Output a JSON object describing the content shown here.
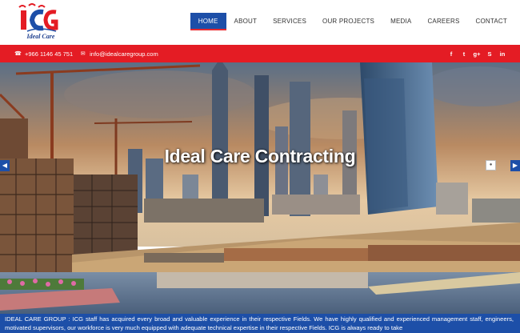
{
  "brand": {
    "logo_text": "Ideal Care",
    "logo_letters": "ICG",
    "colors": {
      "red": "#e41c24",
      "blue": "#1d4fa8"
    }
  },
  "nav": {
    "items": [
      {
        "label": "HOME",
        "active": true
      },
      {
        "label": "ABOUT",
        "active": false
      },
      {
        "label": "SERVICES",
        "active": false
      },
      {
        "label": "OUR PROJECTS",
        "active": false
      },
      {
        "label": "MEDIA",
        "active": false
      },
      {
        "label": "CAREERS",
        "active": false
      },
      {
        "label": "CONTACT",
        "active": false
      }
    ]
  },
  "topbar": {
    "phone_icon": "phone-icon",
    "phone": "+966 1146 45 751",
    "email_icon": "envelope-icon",
    "email": "info@idealcaregroup.com",
    "social": [
      {
        "icon": "facebook-icon",
        "glyph": "f"
      },
      {
        "icon": "twitter-icon",
        "glyph": "t"
      },
      {
        "icon": "google-plus-icon",
        "glyph": "g+"
      },
      {
        "icon": "skype-icon",
        "glyph": "S"
      },
      {
        "icon": "linkedin-icon",
        "glyph": "in"
      }
    ]
  },
  "hero": {
    "title": "Ideal Care Contracting",
    "prev_icon": "chevron-left-icon",
    "next_icon": "chevron-right-icon",
    "indicator_icon": "slide-dot-icon"
  },
  "intro": {
    "text": "IDEAL CARE GROUP : ICG staff has acquired every broad and valuable experience in their respective Fields. We have highly qualified and experienced management staff, engineers, motivated supervisors, our workforce is very much equipped with adequate technical expertise in their respective Fields. ICG is always ready to take"
  }
}
